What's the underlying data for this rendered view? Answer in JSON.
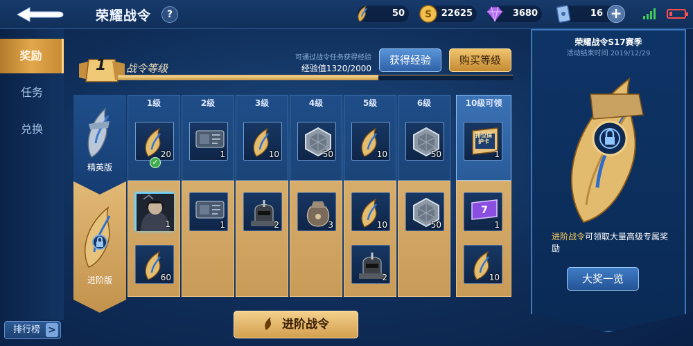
{
  "topbar": {
    "title": "荣耀战令",
    "help_label": "?",
    "currencies": [
      {
        "name": "battlepass-token-icon",
        "value": "50"
      },
      {
        "name": "gold-coin-icon",
        "value": "22625"
      },
      {
        "name": "diamond-icon",
        "value": "3680"
      },
      {
        "name": "coupon-icon",
        "value": "16"
      }
    ],
    "plus_label": "+"
  },
  "nav": {
    "tabs": [
      "奖励",
      "任务",
      "兑换"
    ],
    "active_index": 0,
    "rank_label": "排行榜",
    "rank_chevron": ">"
  },
  "level": {
    "number": "1",
    "title": "战令等级",
    "hint": "可通过战令任务获得经验",
    "xp_text": "经验值1320/2000",
    "xp_progress": 0.66,
    "gain_xp_label": "获得经验",
    "buy_level_label": "购买等级"
  },
  "tracks": {
    "elite_label": "精英版",
    "advanced_label": "进阶版"
  },
  "columns": [
    {
      "header": "1级",
      "elite": [
        {
          "icon": "battlepass-token-icon",
          "count": "20",
          "claimed": true
        }
      ],
      "advanced": [
        {
          "icon": "hero-portrait-icon",
          "count": "1"
        },
        {
          "icon": "battlepass-token-icon",
          "count": "60"
        }
      ]
    },
    {
      "header": "2级",
      "elite": [
        {
          "icon": "ticket-icon",
          "count": "1"
        }
      ],
      "advanced": [
        {
          "icon": "ticket-icon",
          "count": "1"
        }
      ]
    },
    {
      "header": "3级",
      "elite": [
        {
          "icon": "battlepass-token-icon",
          "count": "10"
        }
      ],
      "advanced": [
        {
          "icon": "helmet-icon",
          "count": "2"
        }
      ]
    },
    {
      "header": "4级",
      "elite": [
        {
          "icon": "hexagon-fragment-icon",
          "count": "50"
        }
      ],
      "advanced": [
        {
          "icon": "treasure-bag-icon",
          "count": "3"
        }
      ]
    },
    {
      "header": "5级",
      "elite": [
        {
          "icon": "battlepass-token-icon",
          "count": "10"
        }
      ],
      "advanced": [
        {
          "icon": "battlepass-token-icon",
          "count": "10"
        },
        {
          "icon": "helmet-icon",
          "count": "2"
        }
      ]
    },
    {
      "header": "6级",
      "elite": [
        {
          "icon": "hexagon-fragment-icon",
          "count": "50"
        }
      ],
      "advanced": [
        {
          "icon": "hexagon-fragment-icon",
          "count": "50"
        }
      ]
    },
    {
      "header": "10级可领",
      "elite": [
        {
          "icon": "rank-protect-card-icon",
          "count": "1",
          "card_text": "排位保护卡"
        }
      ],
      "advanced": [
        {
          "icon": "purple-ticket-icon",
          "count": "1"
        },
        {
          "icon": "battlepass-token-icon",
          "count": "10"
        }
      ]
    }
  ],
  "advance_button_label": "进阶战令",
  "season": {
    "title": "荣耀战令S17赛季",
    "end_text": "活动结束时间 2019/12/29",
    "promo_highlight": "进阶战令",
    "promo_rest": "可领取大量高级专属奖励",
    "prize_button_label": "大奖一览"
  },
  "colors": {
    "gold_accent": "#e2a74c",
    "blue_bg": "#0f2d58",
    "battery_low": "#ff4d4d",
    "signal_green": "#3fd05a"
  }
}
